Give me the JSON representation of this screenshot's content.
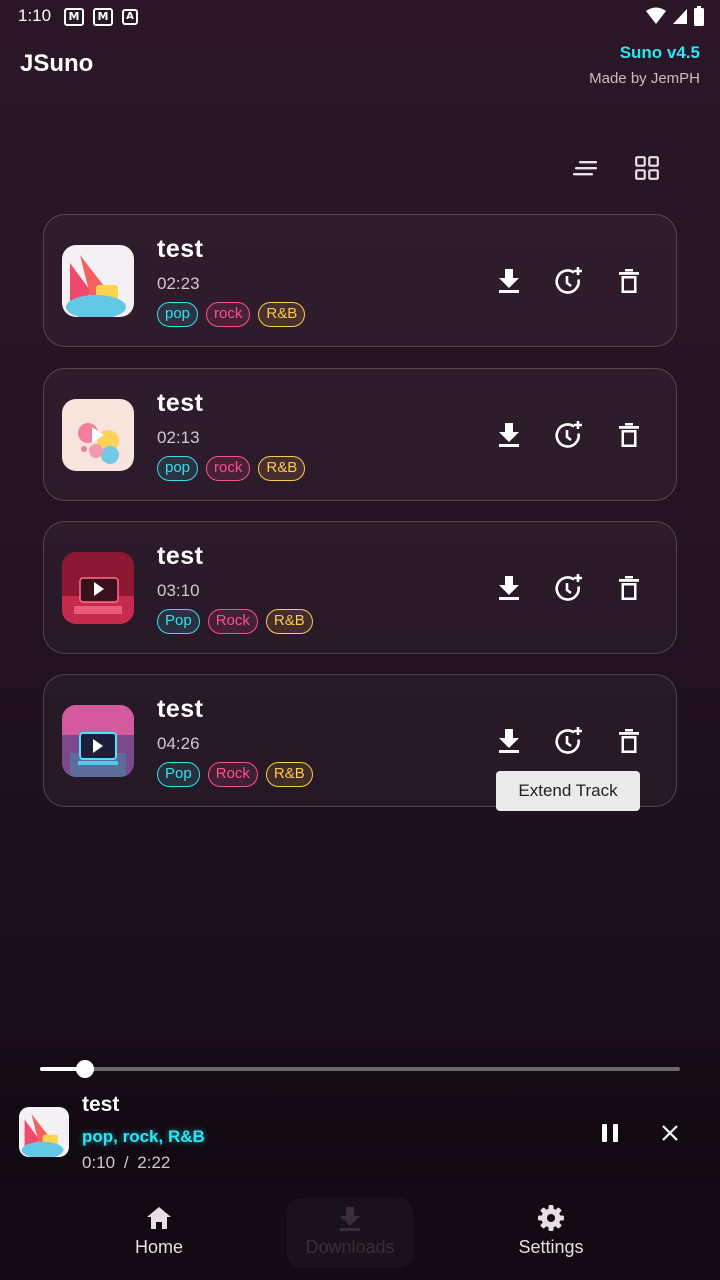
{
  "status_bar": {
    "time": "1:10",
    "notifications": [
      "M",
      "M",
      "A"
    ]
  },
  "header": {
    "title": "JSuno",
    "version": "Suno v4.5",
    "made_by": "Made by JemPH"
  },
  "toolbar": {
    "list_view_icon": "sort-lines-icon",
    "grid_view_icon": "grid-icon"
  },
  "tracks": [
    {
      "title": "test",
      "duration": "02:23",
      "tags": [
        "pop",
        "rock",
        "R&B"
      ]
    },
    {
      "title": "test",
      "duration": "02:13",
      "tags": [
        "pop",
        "rock",
        "R&B"
      ]
    },
    {
      "title": "test",
      "duration": "03:10",
      "tags": [
        "Pop",
        "Rock",
        "R&B"
      ]
    },
    {
      "title": "test",
      "duration": "04:26",
      "tags": [
        "Pop",
        "Rock",
        "R&B"
      ]
    }
  ],
  "track_actions": {
    "download_icon": "download-icon",
    "extend_icon": "clock-plus-icon",
    "delete_icon": "trash-icon"
  },
  "tooltip": "Extend Track",
  "player": {
    "title": "test",
    "tags": "pop, rock, R&B",
    "current_time": "0:10",
    "separator": "/",
    "total_time": "2:22",
    "progress": 0.07
  },
  "nav": {
    "items": [
      {
        "label": "Home",
        "icon": "home-icon",
        "disabled": false
      },
      {
        "label": "Downloads",
        "icon": "download-icon",
        "disabled": true
      },
      {
        "label": "Settings",
        "icon": "gear-icon",
        "disabled": false
      }
    ]
  },
  "colors": {
    "accent": "#2ee6f2",
    "tag_pop": "#33e0ee",
    "tag_rock": "#ff4f8b",
    "tag_rnb": "#ffc94a"
  }
}
